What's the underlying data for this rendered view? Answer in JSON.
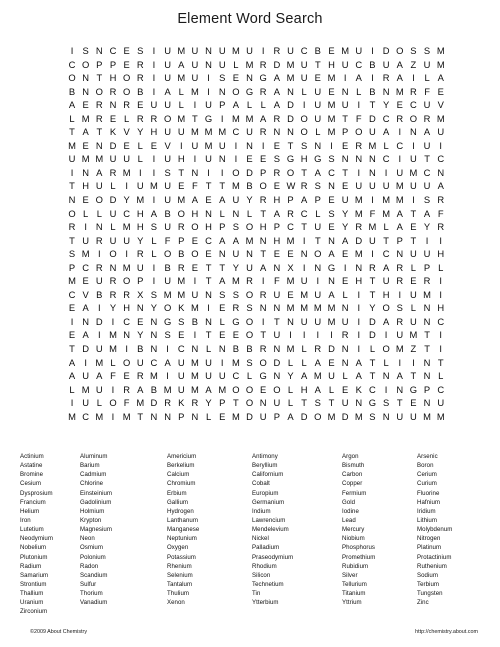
{
  "title": "Element Word Search",
  "grid": {
    "rows": 27,
    "cols": 33,
    "letters": [
      "ISNCESIUMUNUMUIRUCBEMUIDOSSM",
      "COPPERIUAUNULMRDMUTHUCBUAZUM",
      "ONTHORIUMUISENGAMUEMIAIRAILA",
      "BNOROBIALMINOGRANLUENLBNMRFE",
      "AERNREUULIUPALLADIUMUITYECUV",
      "LMRELRROMTGIMMARDOUMTFDCRORM",
      "TATKVYHUUMMMCURNNOLMPOUAINAU",
      "MENDELEVIUMUINIETSNIERMLCIUI",
      "UMMUULIUHIUNIEESGHGSNNNCIUTC",
      "INARMIISTNIIODPROTACTINIUMCN",
      "THULIUMUEFTTMBOEWRSNEUUUMUUA",
      "NEODYMIUMAEAUYRHPAPEUMIMMISR",
      "OLLUCHABOHNLNLTARCLSYMFMATAF",
      "RINLMHSUROHPSOHPCTUEYRMLAEYR",
      "TURUUYLFPECAAMNHMITNADUTPTII",
      "SMIOIRLOBOENUNTEENOAEMICNUUH",
      "PCRNMUIBRETTYUANXINGINRARLPL",
      "MEUROPIUMITAMRIFMUINEHTURERI",
      "CVBRRXSMMUNSSORUEMUALITHIUMI",
      "EAIYHNYOKMIERSNNMMMMNIYOSLNH",
      "INDICENGSBNLGOITNUUMUIDARUNC",
      "EAIMNYNSEITEEOTUIIIIRIDIUMTI",
      "TDUMIBNICNLNBBRNMLRDNILOMZTI",
      "AIMLOUCAUMUIMSODLLAENATLIINT",
      "AUAFERMIUMUUCLGNYAMULATNATNL",
      "LMUIRABMUMAMOOEOLHALEKCINGPC",
      "IULOFMDRKRYPTONULTSTUNGSTENU",
      "MCMIMTNNPNLEMDUPADOMDMSNUUMM"
    ]
  },
  "wordlist": {
    "columns": [
      {
        "words": [
          "Actinium",
          "Astatine",
          "Bromine",
          "Cesium",
          "Dysprosium",
          "Francium",
          "Helium",
          "Iron",
          "Lutetium",
          "Neodymium",
          "Nobelium",
          "Plutonium",
          "Radium",
          "Samarium",
          "Strontium",
          "Thallium",
          "Uranium",
          "Zirconium"
        ]
      },
      {
        "words": [
          "Aluminum",
          "Barium",
          "Cadmium",
          "Chlorine",
          "Einsteinium",
          "Gadolinium",
          "Holmium",
          "Krypton",
          "Magnesium",
          "Neon",
          "Osmium",
          "Polonium",
          "Radon",
          "Scandium",
          "Sulfur",
          "Thorium",
          "Vanadium"
        ]
      },
      {
        "words": [
          "Americium",
          "Berkelium",
          "Calcium",
          "Chromium",
          "Erbium",
          "Gallium",
          "Hydrogen",
          "Lanthanum",
          "Manganese",
          "Neptunium",
          "Oxygen",
          "Potassium",
          "Rhenium",
          "Selenium",
          "Tantalum",
          "Thulium",
          "Xenon"
        ]
      },
      {
        "words": [
          "Antimony",
          "Beryllium",
          "Californium",
          "Cobalt",
          "Europium",
          "Germanium",
          "Indium",
          "Lawrencium",
          "Mendelevium",
          "Nickel",
          "Palladium",
          "Praseodymium",
          "Rhodium",
          "Silicon",
          "Technetium",
          "Tin",
          "Ytterbium"
        ]
      },
      {
        "words": [
          "Argon",
          "Bismuth",
          "Carbon",
          "Copper",
          "Fermium",
          "Gold",
          "Iodine",
          "Lead",
          "Mercury",
          "Niobium",
          "Phosphorus",
          "Promethium",
          "Rubidium",
          "Silver",
          "Tellurium",
          "Titanium",
          "Yttrium"
        ]
      },
      {
        "words": [
          "Arsenic",
          "Boron",
          "Cerium",
          "Curium",
          "Fluorine",
          "Hafnium",
          "Iridium",
          "Lithium",
          "Molybdenum",
          "Nitrogen",
          "Platinum",
          "Protactinium",
          "Ruthenium",
          "Sodium",
          "Terbium",
          "Tungsten",
          "Zinc"
        ]
      }
    ]
  },
  "footer": {
    "copyright": "©2009 About Chemistry",
    "url": "http://chemistry.about.com"
  }
}
